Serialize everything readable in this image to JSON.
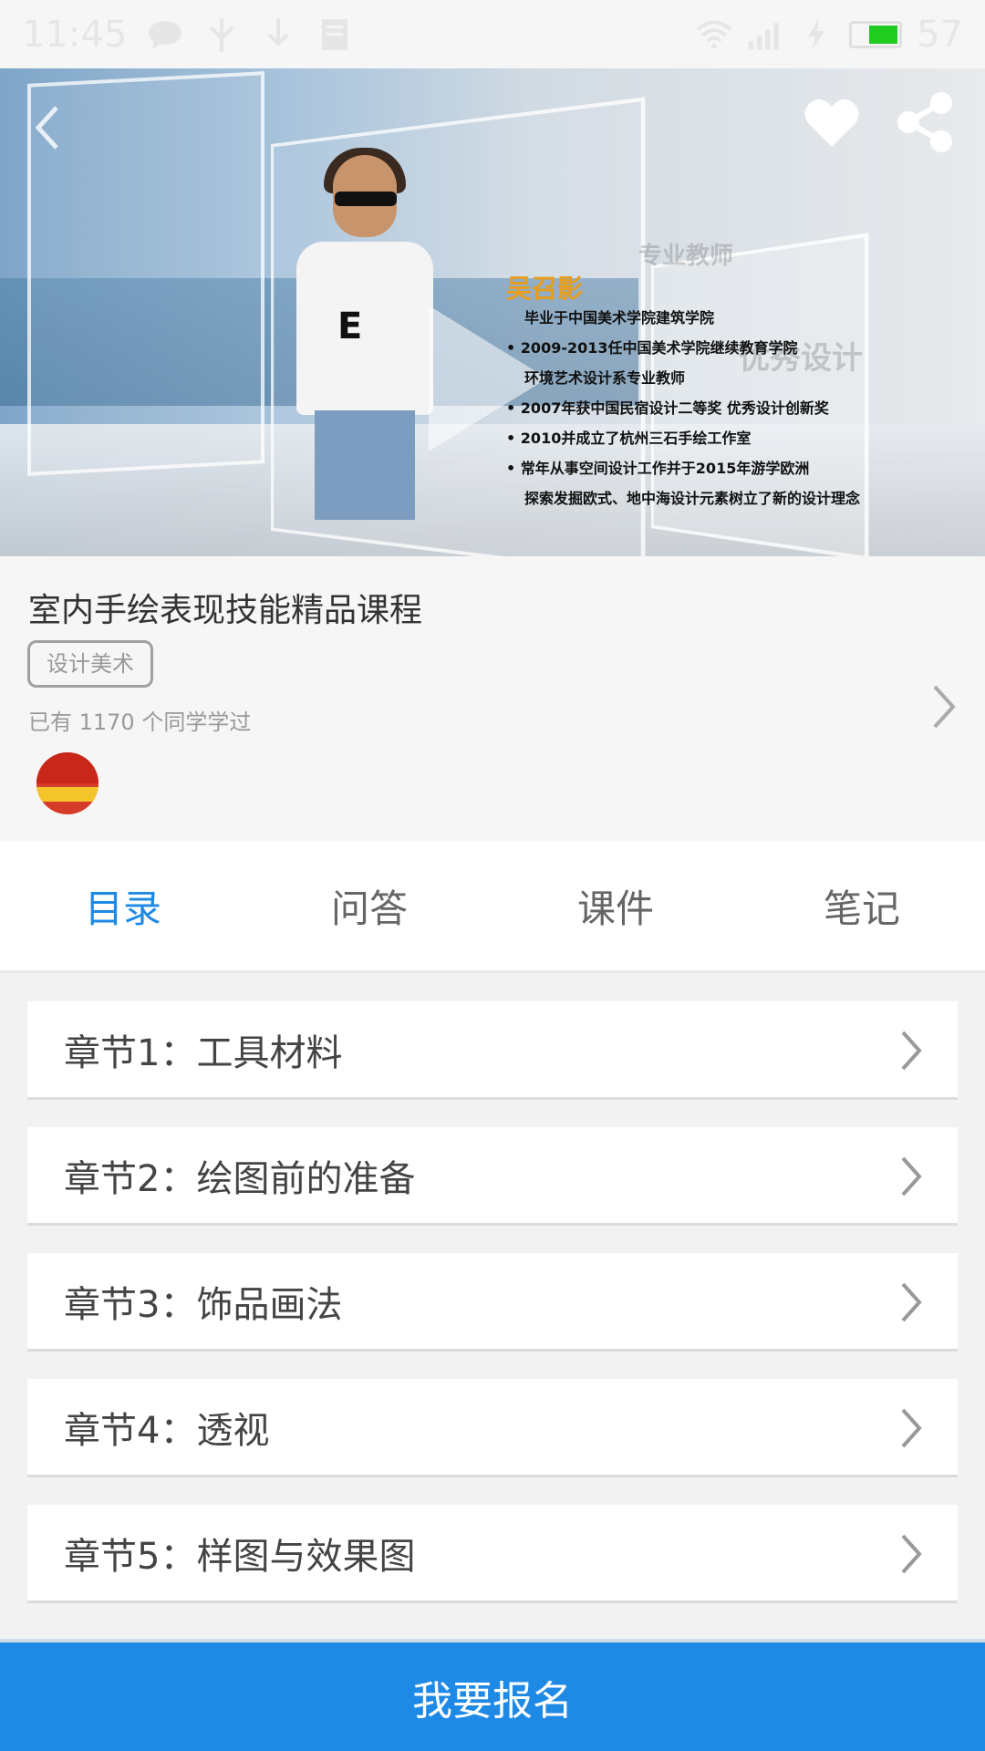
{
  "status_bar": {
    "time": "11:45",
    "battery_level": "57",
    "icons": [
      "chat-icon",
      "usb-icon",
      "download-icon",
      "wifi-icon",
      "signal-icon",
      "charging-icon",
      "battery-icon"
    ],
    "battery_fill_fraction": 0.57
  },
  "hero": {
    "teacher_name": "吴召影",
    "watermark_1": "专业教师",
    "watermark_2": "优秀设计",
    "bio": [
      "毕业于中国美术学院建筑学院",
      "• 2009-2013任中国美术学院继续教育学院",
      "环境艺术设计系专业教师",
      "• 2007年获中国民宿设计二等奖 优秀设计创新奖",
      "• 2010并成立了杭州三石手绘工作室",
      "• 常年从事空间设计工作并于2015年游学欧洲",
      "探索发掘欧式、地中海设计元素树立了新的设计理念"
    ],
    "icons": [
      "back-icon",
      "heart-icon",
      "share-icon",
      "play-icon"
    ]
  },
  "course": {
    "title": "室内手绘表现技能精品课程",
    "tag": "设计美术",
    "learners": "已有 1170 个同学学过"
  },
  "tabs": [
    {
      "label": "目录",
      "active": true
    },
    {
      "label": "问答",
      "active": false
    },
    {
      "label": "课件",
      "active": false
    },
    {
      "label": "笔记",
      "active": false
    }
  ],
  "chapters": [
    {
      "label": "章节1：工具材料"
    },
    {
      "label": "章节2：绘图前的准备"
    },
    {
      "label": "章节3：饰品画法"
    },
    {
      "label": "章节4：透视"
    },
    {
      "label": "章节5：样图与效果图"
    }
  ],
  "enroll_button": "我要报名",
  "colors": {
    "accent": "#1e8ae6",
    "teacher_name": "#e89c1c",
    "battery": "#1fcc1f"
  }
}
